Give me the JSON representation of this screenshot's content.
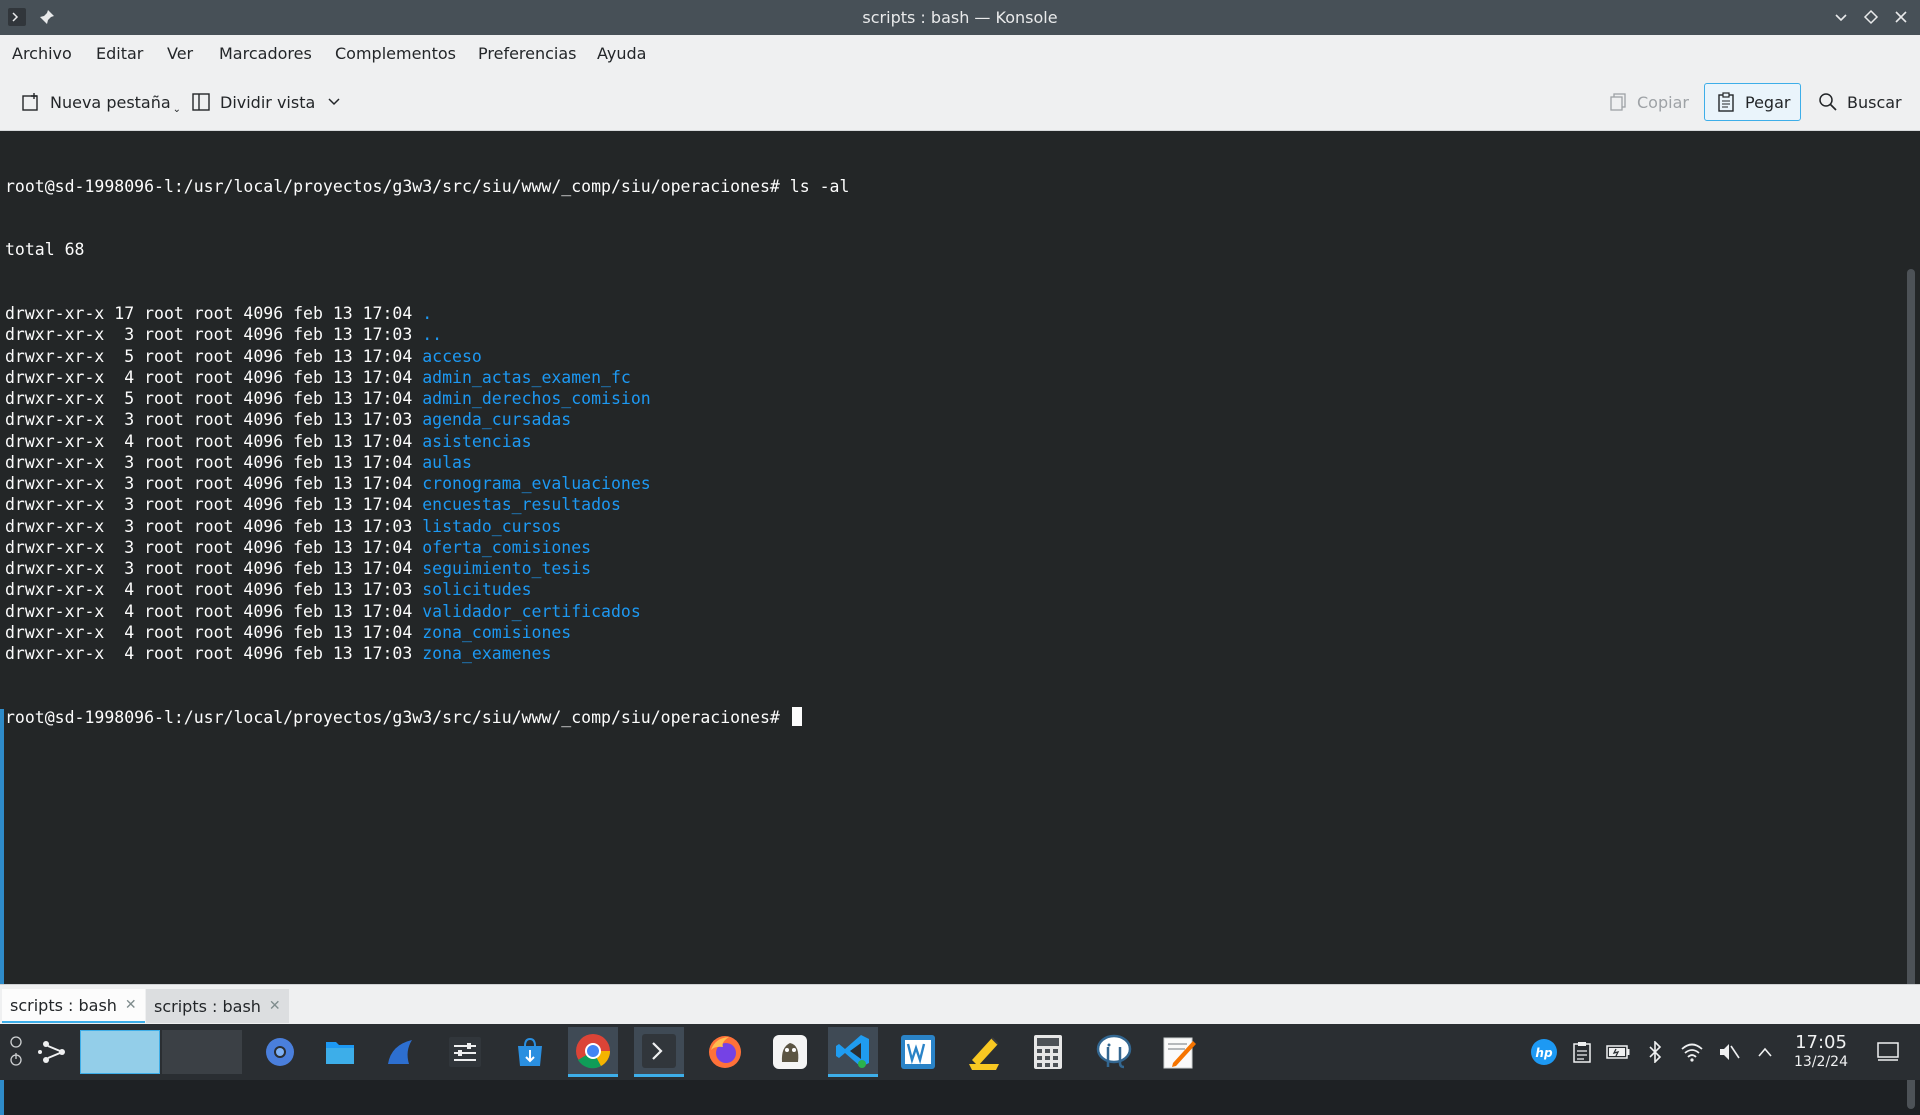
{
  "window": {
    "title": "scripts : bash — Konsole"
  },
  "menubar": {
    "items": [
      "Archivo",
      "Editar",
      "Ver",
      "Marcadores",
      "Complementos",
      "Preferencias",
      "Ayuda"
    ]
  },
  "toolbar": {
    "new_tab_label": "Nueva pestaña",
    "split_view_label": "Dividir vista",
    "copy_label": "Copiar",
    "paste_label": "Pegar",
    "search_label": "Buscar"
  },
  "terminal": {
    "prompt": "root@sd-1998096-l:/usr/local/proyectos/g3w3/src/siu/www/_comp/siu/operaciones# ",
    "command": "ls -al",
    "total": "total 68",
    "entries": [
      {
        "perms": "drwxr-xr-x 17 root root 4096 feb 13 17:04 ",
        "name": "."
      },
      {
        "perms": "drwxr-xr-x  3 root root 4096 feb 13 17:03 ",
        "name": ".."
      },
      {
        "perms": "drwxr-xr-x  5 root root 4096 feb 13 17:04 ",
        "name": "acceso"
      },
      {
        "perms": "drwxr-xr-x  4 root root 4096 feb 13 17:04 ",
        "name": "admin_actas_examen_fc"
      },
      {
        "perms": "drwxr-xr-x  5 root root 4096 feb 13 17:04 ",
        "name": "admin_derechos_comision"
      },
      {
        "perms": "drwxr-xr-x  3 root root 4096 feb 13 17:03 ",
        "name": "agenda_cursadas"
      },
      {
        "perms": "drwxr-xr-x  4 root root 4096 feb 13 17:04 ",
        "name": "asistencias"
      },
      {
        "perms": "drwxr-xr-x  3 root root 4096 feb 13 17:04 ",
        "name": "aulas"
      },
      {
        "perms": "drwxr-xr-x  3 root root 4096 feb 13 17:04 ",
        "name": "cronograma_evaluaciones"
      },
      {
        "perms": "drwxr-xr-x  3 root root 4096 feb 13 17:04 ",
        "name": "encuestas_resultados"
      },
      {
        "perms": "drwxr-xr-x  3 root root 4096 feb 13 17:03 ",
        "name": "listado_cursos"
      },
      {
        "perms": "drwxr-xr-x  3 root root 4096 feb 13 17:04 ",
        "name": "oferta_comisiones"
      },
      {
        "perms": "drwxr-xr-x  3 root root 4096 feb 13 17:04 ",
        "name": "seguimiento_tesis"
      },
      {
        "perms": "drwxr-xr-x  4 root root 4096 feb 13 17:03 ",
        "name": "solicitudes"
      },
      {
        "perms": "drwxr-xr-x  4 root root 4096 feb 13 17:04 ",
        "name": "validador_certificados"
      },
      {
        "perms": "drwxr-xr-x  4 root root 4096 feb 13 17:04 ",
        "name": "zona_comisiones"
      },
      {
        "perms": "drwxr-xr-x  4 root root 4096 feb 13 17:03 ",
        "name": "zona_examenes"
      }
    ],
    "dir_color": "#1d99f3"
  },
  "tabs": [
    {
      "label": "scripts : bash",
      "active": true
    },
    {
      "label": "scripts : bash",
      "active": false
    }
  ],
  "taskbar": {
    "clock_time": "17:05",
    "clock_date": "13/2/24",
    "apps": [
      "chromium-icon",
      "file-manager-icon",
      "kde-connect-icon",
      "system-settings-icon",
      "discover-icon",
      "chrome-icon",
      "konsole-icon",
      "firefox-icon",
      "gimp-icon",
      "vscode-icon",
      "wps-writer-icon",
      "notes-icon",
      "calculator-icon",
      "postgresql-icon",
      "text-editor-icon"
    ]
  },
  "colors": {
    "accent": "#3daee9",
    "titlebar": "#475057",
    "terminal_bg": "#232627"
  }
}
